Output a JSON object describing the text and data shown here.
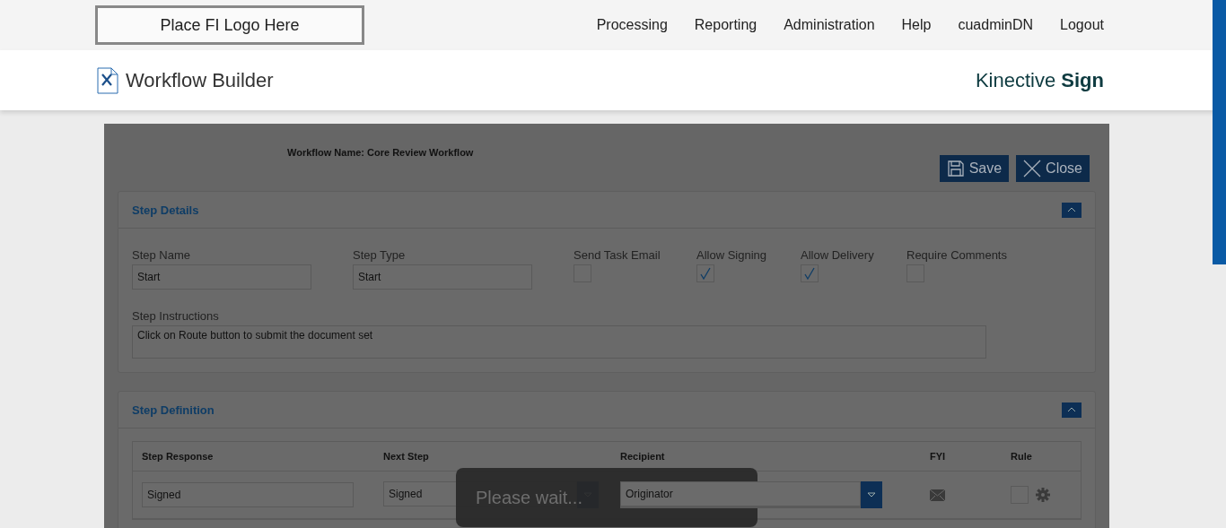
{
  "logo": {
    "text": "Place FI Logo Here"
  },
  "nav": [
    "Processing",
    "Reporting",
    "Administration",
    "Help",
    "cuadminDN",
    "Logout"
  ],
  "page_title": "Workflow Builder",
  "brand": {
    "light": "Kinective",
    "bold": "Sign"
  },
  "workflow_name": "Workflow Name: Core Review Workflow",
  "actions": [
    {
      "kind": "save",
      "label": "Save"
    },
    {
      "kind": "close",
      "label": "Close"
    }
  ],
  "step_details": {
    "title": "Step Details",
    "expanded": true,
    "fields": [
      {
        "label": "Step Name",
        "value": "Start"
      },
      {
        "label": "Step Type",
        "value": "Start"
      }
    ],
    "checkboxes": [
      {
        "label": "Send Task Email",
        "checked": false
      },
      {
        "label": "Allow Signing",
        "checked": true
      },
      {
        "label": "Allow Delivery",
        "checked": true
      },
      {
        "label": "Require Comments",
        "checked": false
      }
    ],
    "instructions": {
      "label": "Step Instructions",
      "value": "Click on Route button to submit the document set"
    }
  },
  "step_definition": {
    "title": "Step Definition",
    "expanded": true,
    "columns": [
      "Step Response",
      "Next Step",
      "Recipient",
      "FYI",
      "Rule"
    ],
    "rows": [
      {
        "response": "Signed",
        "next_step": "Signed",
        "recipient": "Originator",
        "rule_checked": false
      }
    ]
  },
  "loading": {
    "text": "Please wait..."
  }
}
